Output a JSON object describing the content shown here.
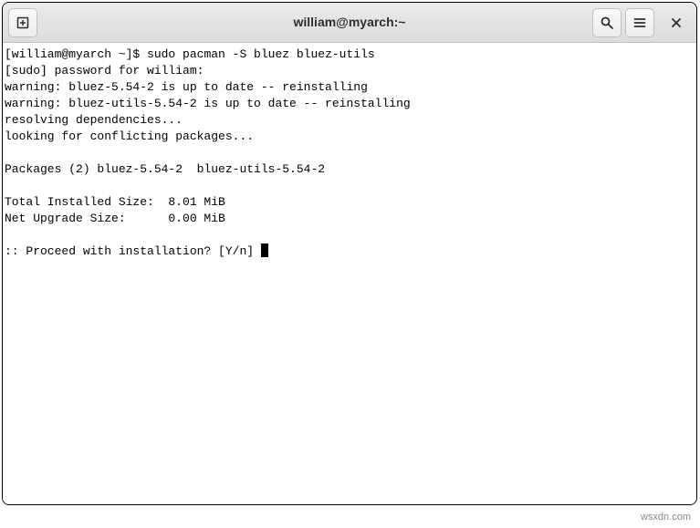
{
  "titlebar": {
    "title": "william@myarch:~"
  },
  "terminal": {
    "prompt": "[william@myarch ~]$ ",
    "command": "sudo pacman -S bluez bluez-utils",
    "lines": [
      "[sudo] password for william:",
      "warning: bluez-5.54-2 is up to date -- reinstalling",
      "warning: bluez-utils-5.54-2 is up to date -- reinstalling",
      "resolving dependencies...",
      "looking for conflicting packages...",
      "",
      "Packages (2) bluez-5.54-2  bluez-utils-5.54-2",
      "",
      "Total Installed Size:  8.01 MiB",
      "Net Upgrade Size:      0.00 MiB",
      "",
      ":: Proceed with installation? [Y/n] "
    ]
  },
  "watermark": "wsxdn.com"
}
